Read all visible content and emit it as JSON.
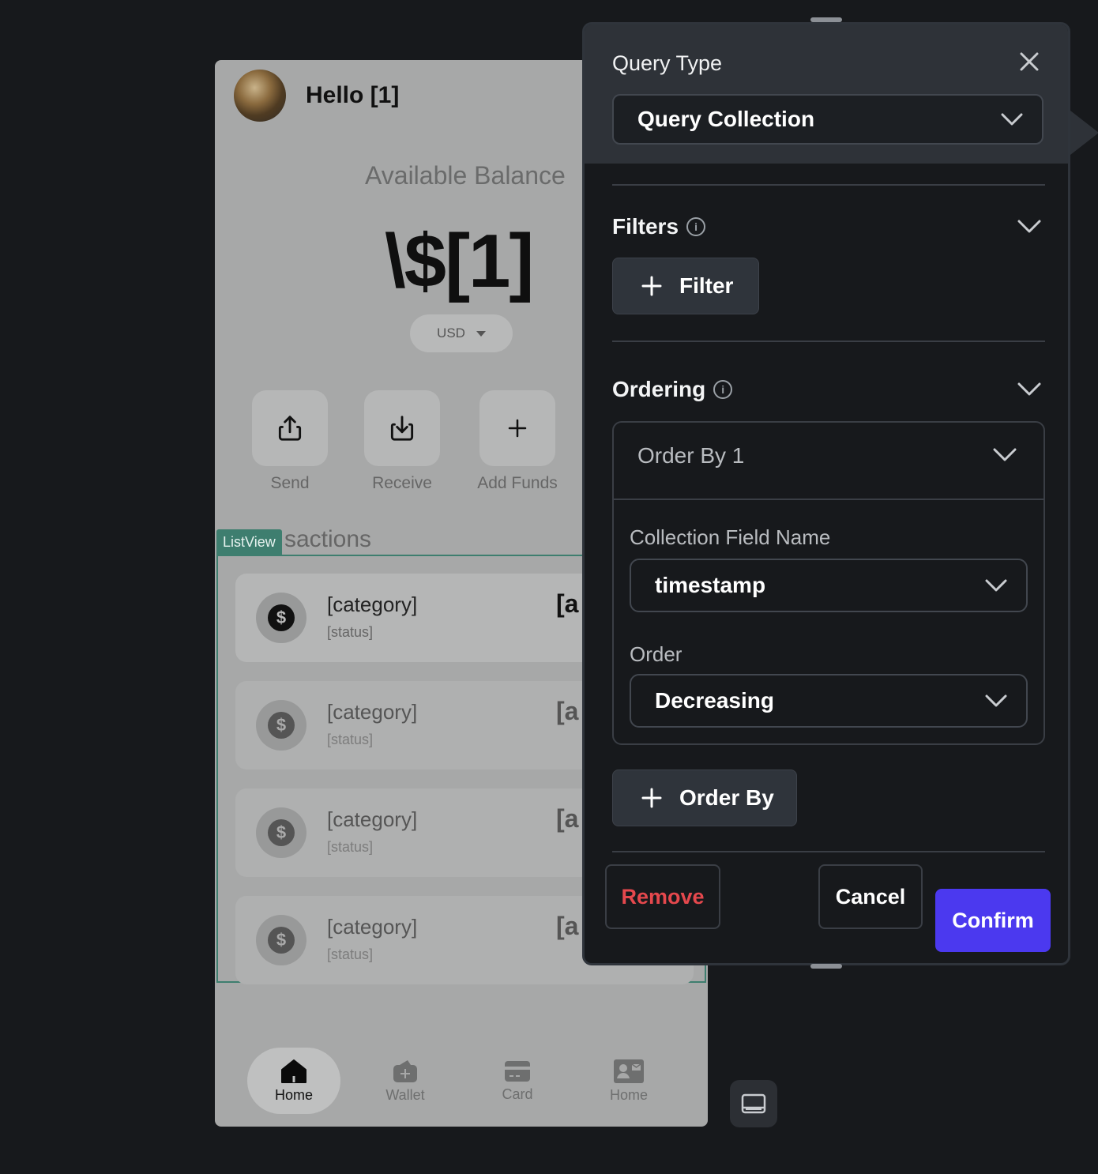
{
  "phone": {
    "greeting": "Hello [1]",
    "balance_label": "Available Balance",
    "balance_value": "\\$[1]",
    "currency": "USD",
    "actions": [
      {
        "label": "Send",
        "icon": "share-up-icon"
      },
      {
        "label": "Receive",
        "icon": "download-icon"
      },
      {
        "label": "Add Funds",
        "icon": "plus-icon"
      }
    ],
    "list_tag": "ListView",
    "list_title": "sactions",
    "transactions": [
      {
        "category": "[category]",
        "status": "[status]",
        "amount": "[a",
        "icon": "dollar-icon"
      },
      {
        "category": "[category]",
        "status": "[status]",
        "amount": "[a",
        "icon": "dollar-icon"
      },
      {
        "category": "[category]",
        "status": "[status]",
        "amount": "[a",
        "icon": "dollar-icon"
      },
      {
        "category": "[category]",
        "status": "[status]",
        "amount": "[a",
        "icon": "dollar-icon"
      }
    ],
    "nav": [
      {
        "label": "Home",
        "icon": "home-icon",
        "active": true
      },
      {
        "label": "Wallet",
        "icon": "wallet-icon",
        "active": false
      },
      {
        "label": "Card",
        "icon": "card-icon",
        "active": false
      },
      {
        "label": "Home",
        "icon": "contact-card-icon",
        "active": false
      }
    ]
  },
  "panel": {
    "query_type_label": "Query Type",
    "query_type_value": "Query Collection",
    "filters_title": "Filters",
    "filter_button": "Filter",
    "ordering_title": "Ordering",
    "order_by_header": "Order By 1",
    "collection_field_label": "Collection Field Name",
    "collection_field_value": "timestamp",
    "order_label": "Order",
    "order_value": "Decreasing",
    "order_by_button": "Order By",
    "remove_button": "Remove",
    "cancel_button": "Cancel",
    "confirm_button": "Confirm"
  },
  "colors": {
    "accent": "#4b39ef",
    "danger": "#e5484d",
    "listview_outline": "#3e7e6f",
    "panel_bg": "#17191c",
    "panel_header_bg": "#2e3238"
  }
}
